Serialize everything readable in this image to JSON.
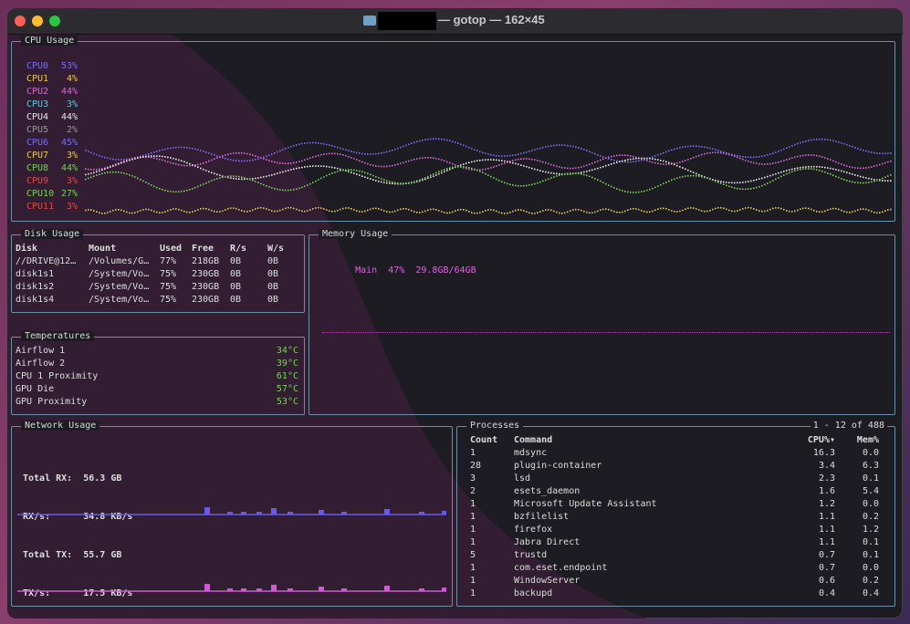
{
  "window": {
    "title": "— gotop — 162×45"
  },
  "cpu": {
    "title": "CPU Usage",
    "cores": [
      {
        "name": "CPU0",
        "value": "53%",
        "color": "#7b6cf0"
      },
      {
        "name": "CPU1",
        "value": "4%",
        "color": "#e6c85a"
      },
      {
        "name": "CPU2",
        "value": "44%",
        "color": "#d56ad5"
      },
      {
        "name": "CPU3",
        "value": "3%",
        "color": "#5fc6d8"
      },
      {
        "name": "CPU4",
        "value": "44%",
        "color": "#e8e8e8"
      },
      {
        "name": "CPU5",
        "value": "2%",
        "color": "#9a9a9a"
      },
      {
        "name": "CPU6",
        "value": "45%",
        "color": "#7b6cf0"
      },
      {
        "name": "CPU7",
        "value": "3%",
        "color": "#e6c85a"
      },
      {
        "name": "CPU8",
        "value": "44%",
        "color": "#7ccf5a"
      },
      {
        "name": "CPU9",
        "value": "3%",
        "color": "#e24a4a"
      },
      {
        "name": "CPU10",
        "value": "27%",
        "color": "#7ccf5a"
      },
      {
        "name": "CPU11",
        "value": "3%",
        "color": "#e24a4a"
      }
    ]
  },
  "disk": {
    "title": "Disk Usage",
    "headers": [
      "Disk",
      "Mount",
      "Used",
      "Free",
      "R/s",
      "W/s"
    ],
    "rows": [
      [
        "//DRIVE@12…",
        "/Volumes/G…",
        "77%",
        "218GB",
        "0B",
        "0B"
      ],
      [
        "disk1s1",
        "/System/Vo…",
        "75%",
        "230GB",
        "0B",
        "0B"
      ],
      [
        "disk1s2",
        "/System/Vo…",
        "75%",
        "230GB",
        "0B",
        "0B"
      ],
      [
        "disk1s4",
        "/System/Vo…",
        "75%",
        "230GB",
        "0B",
        "0B"
      ]
    ]
  },
  "memory": {
    "title": "Memory Usage",
    "main_label": "Main",
    "main_percent": "47%",
    "main_amount": "29.8GB/64GB",
    "color": "#d56ad5"
  },
  "temps": {
    "title": "Temperatures",
    "rows": [
      {
        "name": "Airflow 1",
        "value": "34°C"
      },
      {
        "name": "Airflow 2",
        "value": "39°C"
      },
      {
        "name": "CPU 1 Proximity",
        "value": "61°C"
      },
      {
        "name": "GPU Die",
        "value": "57°C"
      },
      {
        "name": "GPU Proximity",
        "value": "53°C"
      }
    ],
    "value_color": "#7ccf5a"
  },
  "network": {
    "title": "Network Usage",
    "total_rx_label": "Total RX:",
    "total_rx": "56.3 GB",
    "rx_rate_label": "RX/s:",
    "rx_rate": "34.8 KB/s",
    "total_tx_label": "Total TX:",
    "total_tx": "55.7 GB",
    "tx_rate_label": "TX/s:",
    "tx_rate": "17.5 KB/s",
    "rx_color": "#6a5ae8",
    "tx_color": "#d05ad5"
  },
  "processes": {
    "title": "Processes",
    "range": "1 - 12 of 488",
    "headers": [
      "Count",
      "Command",
      "CPU%▾",
      "Mem%"
    ],
    "rows": [
      [
        "1",
        "mdsync",
        "16.3",
        "0.0"
      ],
      [
        "28",
        "plugin-container",
        "3.4",
        "6.3"
      ],
      [
        "3",
        "lsd",
        "2.3",
        "0.1"
      ],
      [
        "2",
        "esets_daemon",
        "1.6",
        "5.4"
      ],
      [
        "1",
        "Microsoft Update Assistant",
        "1.2",
        "0.0"
      ],
      [
        "1",
        "bzfilelist",
        "1.1",
        "0.2"
      ],
      [
        "1",
        "firefox",
        "1.1",
        "1.2"
      ],
      [
        "1",
        "Jabra Direct",
        "1.1",
        "0.1"
      ],
      [
        "5",
        "trustd",
        "0.7",
        "0.1"
      ],
      [
        "1",
        "com.eset.endpoint",
        "0.7",
        "0.0"
      ],
      [
        "1",
        "WindowServer",
        "0.6",
        "0.2"
      ],
      [
        "1",
        "backupd",
        "0.4",
        "0.4"
      ]
    ]
  }
}
